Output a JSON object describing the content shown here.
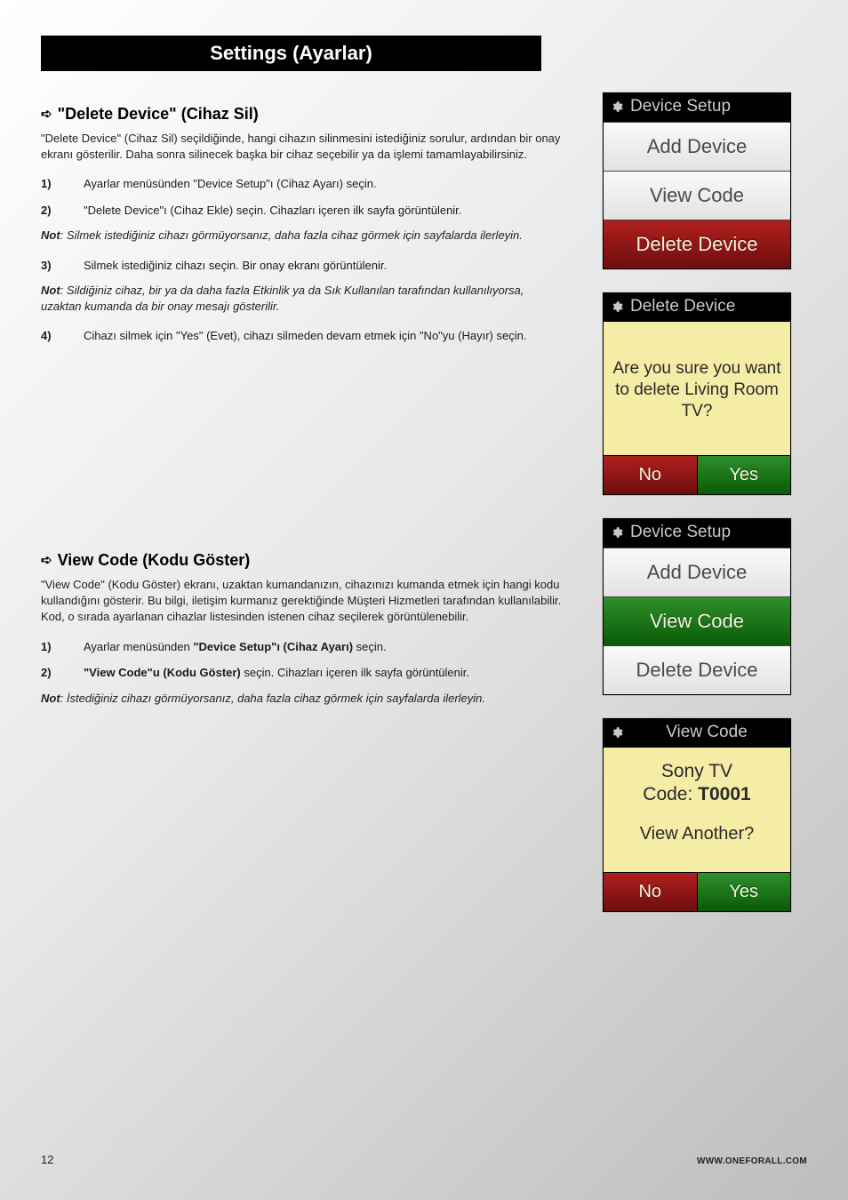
{
  "title": "Settings (Ayarlar)",
  "section1": {
    "heading": "\"Delete Device\" (Cihaz Sil)",
    "intro": "\"Delete Device\" (Cihaz Sil) seçildiğinde, hangi cihazın silinmesini istediğiniz sorulur, ardından bir onay ekranı gösterilir. Daha sonra silinecek başka bir cihaz seçebilir ya da işlemi tamamlayabilirsiniz.",
    "steps": [
      {
        "n": "1)",
        "t": "Ayarlar menüsünden \"Device Setup\"ı (Cihaz Ayarı) seçin."
      },
      {
        "n": "2)",
        "t": "\"Delete Device\"ı (Cihaz Ekle) seçin. Cihazları içeren ilk sayfa görüntülenir."
      }
    ],
    "note1_b": "Not",
    "note1": ": Silmek istediğiniz cihazı görmüyorsanız, daha fazla cihaz görmek için sayfalarda ilerleyin.",
    "step3": {
      "n": "3)",
      "t": "Silmek istediğiniz cihazı seçin. Bir onay ekranı görüntülenir."
    },
    "note2_b": "Not",
    "note2": ": Sildiğiniz cihaz, bir ya da daha fazla Etkinlik ya da Sık Kullanılan tarafından kullanılıyorsa, uzaktan kumanda da bir onay mesajı gösterilir.",
    "step4": {
      "n": "4)",
      "t": "Cihazı silmek için \"Yes\" (Evet), cihazı silmeden devam etmek için \"No\"yu (Hayır) seçin."
    }
  },
  "section2": {
    "heading": "View Code (Kodu Göster)",
    "intro": "\"View Code\" (Kodu Göster) ekranı, uzaktan kumandanızın, cihazınızı kumanda etmek için hangi kodu kullandığını gösterir. Bu bilgi, iletişim kurmanız gerektiğinde Müşteri Hizmetleri tarafından kullanılabilir. Kod, o sırada ayarlanan cihazlar listesinden istenen cihaz seçilerek görüntülenebilir.",
    "step1_n": "1)",
    "step1_pre": "Ayarlar menüsünden ",
    "step1_b": "\"Device Setup\"ı (Cihaz Ayarı)",
    "step1_post": " seçin.",
    "step2_n": "2)",
    "step2_b": "\"View Code\"u (Kodu Göster)",
    "step2_post": " seçin. Cihazları içeren ilk sayfa görüntülenir.",
    "note_b": "Not",
    "note": ": İstediğiniz cihazı görmüyorsanız, daha fazla cihaz görmek için sayfalarda ilerleyin."
  },
  "screens": {
    "s1": {
      "header": "Device Setup",
      "items": [
        "Add Device",
        "View Code",
        "Delete Device"
      ],
      "highlight": 2
    },
    "s2": {
      "header": "Delete Device",
      "prompt": "Are you sure you want to delete Living Room TV?",
      "no": "No",
      "yes": "Yes"
    },
    "s3": {
      "header": "Device Setup",
      "items": [
        "Add Device",
        "View Code",
        "Delete Device"
      ],
      "highlight": 1
    },
    "s4": {
      "header": "View Code",
      "line1": "Sony TV",
      "line2_pre": "Code: ",
      "line2_b": "T0001",
      "prompt2": "View Another?",
      "no": "No",
      "yes": "Yes"
    }
  },
  "footer": {
    "page": "12",
    "url": "WWW.ONEFORALL.COM"
  }
}
